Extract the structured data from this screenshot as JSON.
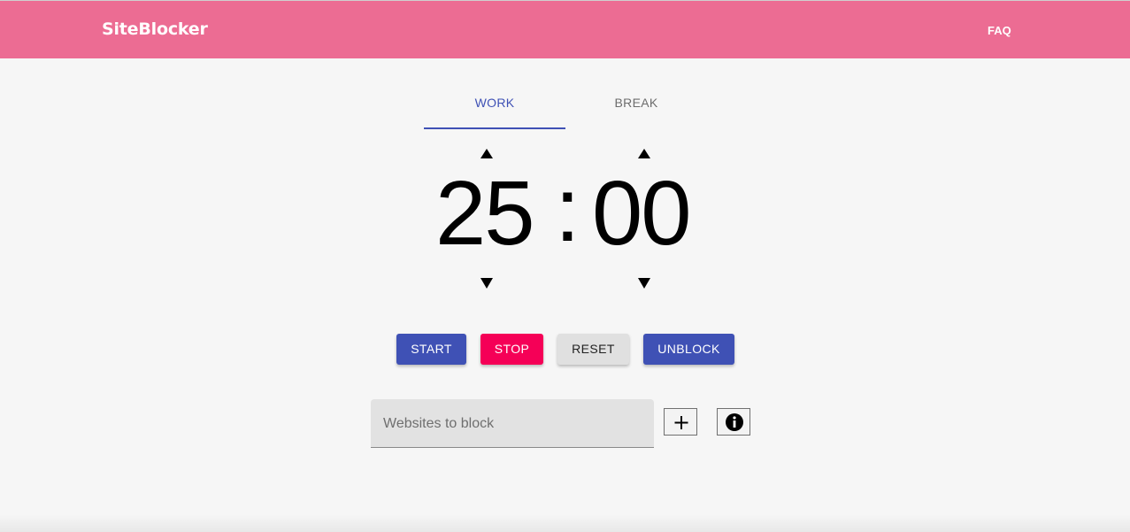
{
  "app": {
    "brand": "SiteBlocker",
    "nav_link": "FAQ",
    "accent_color": "#ec6c93",
    "primary_color": "#3f51b5",
    "danger_color": "#f50057"
  },
  "tabs": {
    "items": [
      {
        "label": "WORK",
        "active": true
      },
      {
        "label": "BREAK",
        "active": false
      }
    ]
  },
  "timer": {
    "minutes": "25",
    "separator": ":",
    "seconds": "00",
    "icons": {
      "minutes_up": "triangle-up-icon",
      "minutes_down": "triangle-down-icon",
      "seconds_up": "triangle-up-icon",
      "seconds_down": "triangle-down-icon"
    }
  },
  "controls": {
    "start_label": "START",
    "stop_label": "STOP",
    "reset_label": "RESET",
    "unblock_label": "UNBLOCK"
  },
  "block_form": {
    "placeholder": "Websites to block",
    "value": "",
    "add_icon": "plus-icon",
    "info_icon": "info-icon"
  }
}
